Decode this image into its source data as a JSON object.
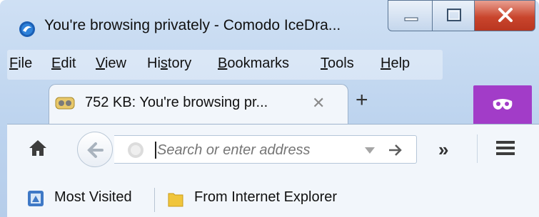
{
  "window": {
    "title": "You're browsing privately - Comodo IceDra...",
    "close_label": "X"
  },
  "menu": {
    "items": [
      {
        "label": "File",
        "accel": "F"
      },
      {
        "label": "Edit",
        "accel": "E"
      },
      {
        "label": "View",
        "accel": "V"
      },
      {
        "label": "History",
        "accel": "s"
      },
      {
        "label": "Bookmarks",
        "accel": "B"
      },
      {
        "label": "Tools",
        "accel": "T"
      },
      {
        "label": "Help",
        "accel": "H"
      }
    ]
  },
  "tab": {
    "title": "752 KB: You're browsing pr...",
    "close_glyph": "✕",
    "new_tab_glyph": "+"
  },
  "navbar": {
    "search_placeholder": "Search or enter address",
    "overflow_glyph": "»"
  },
  "bookmarks": {
    "items": [
      {
        "label": "Most Visited",
        "icon": "bookmark-folder-icon"
      },
      {
        "label": "From Internet Explorer",
        "icon": "folder-icon"
      }
    ]
  },
  "colors": {
    "private_badge": "#a23cc8",
    "close_button": "#c9452d",
    "frame": "#bcd3ee"
  }
}
